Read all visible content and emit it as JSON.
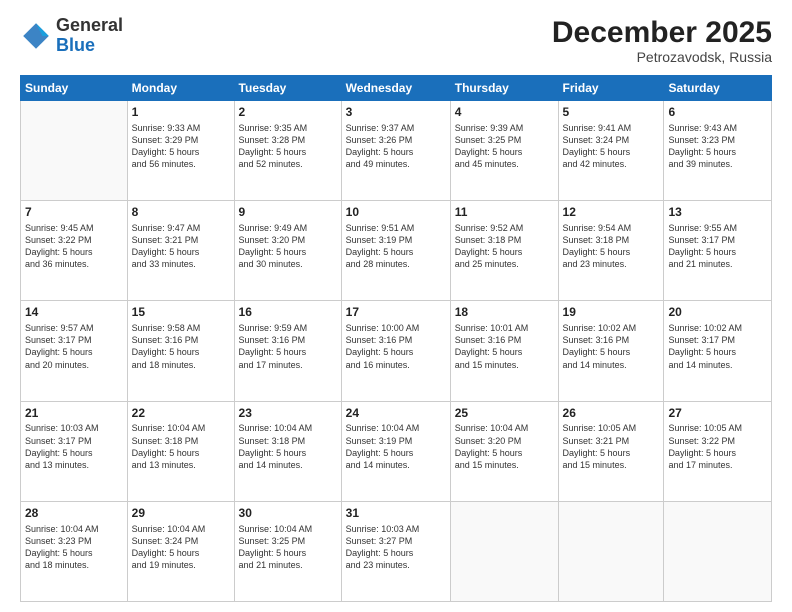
{
  "header": {
    "logo_general": "General",
    "logo_blue": "Blue",
    "month_year": "December 2025",
    "location": "Petrozavodsk, Russia"
  },
  "weekdays": [
    "Sunday",
    "Monday",
    "Tuesday",
    "Wednesday",
    "Thursday",
    "Friday",
    "Saturday"
  ],
  "weeks": [
    [
      {
        "day": "",
        "info": ""
      },
      {
        "day": "1",
        "info": "Sunrise: 9:33 AM\nSunset: 3:29 PM\nDaylight: 5 hours\nand 56 minutes."
      },
      {
        "day": "2",
        "info": "Sunrise: 9:35 AM\nSunset: 3:28 PM\nDaylight: 5 hours\nand 52 minutes."
      },
      {
        "day": "3",
        "info": "Sunrise: 9:37 AM\nSunset: 3:26 PM\nDaylight: 5 hours\nand 49 minutes."
      },
      {
        "day": "4",
        "info": "Sunrise: 9:39 AM\nSunset: 3:25 PM\nDaylight: 5 hours\nand 45 minutes."
      },
      {
        "day": "5",
        "info": "Sunrise: 9:41 AM\nSunset: 3:24 PM\nDaylight: 5 hours\nand 42 minutes."
      },
      {
        "day": "6",
        "info": "Sunrise: 9:43 AM\nSunset: 3:23 PM\nDaylight: 5 hours\nand 39 minutes."
      }
    ],
    [
      {
        "day": "7",
        "info": "Sunrise: 9:45 AM\nSunset: 3:22 PM\nDaylight: 5 hours\nand 36 minutes."
      },
      {
        "day": "8",
        "info": "Sunrise: 9:47 AM\nSunset: 3:21 PM\nDaylight: 5 hours\nand 33 minutes."
      },
      {
        "day": "9",
        "info": "Sunrise: 9:49 AM\nSunset: 3:20 PM\nDaylight: 5 hours\nand 30 minutes."
      },
      {
        "day": "10",
        "info": "Sunrise: 9:51 AM\nSunset: 3:19 PM\nDaylight: 5 hours\nand 28 minutes."
      },
      {
        "day": "11",
        "info": "Sunrise: 9:52 AM\nSunset: 3:18 PM\nDaylight: 5 hours\nand 25 minutes."
      },
      {
        "day": "12",
        "info": "Sunrise: 9:54 AM\nSunset: 3:18 PM\nDaylight: 5 hours\nand 23 minutes."
      },
      {
        "day": "13",
        "info": "Sunrise: 9:55 AM\nSunset: 3:17 PM\nDaylight: 5 hours\nand 21 minutes."
      }
    ],
    [
      {
        "day": "14",
        "info": "Sunrise: 9:57 AM\nSunset: 3:17 PM\nDaylight: 5 hours\nand 20 minutes."
      },
      {
        "day": "15",
        "info": "Sunrise: 9:58 AM\nSunset: 3:16 PM\nDaylight: 5 hours\nand 18 minutes."
      },
      {
        "day": "16",
        "info": "Sunrise: 9:59 AM\nSunset: 3:16 PM\nDaylight: 5 hours\nand 17 minutes."
      },
      {
        "day": "17",
        "info": "Sunrise: 10:00 AM\nSunset: 3:16 PM\nDaylight: 5 hours\nand 16 minutes."
      },
      {
        "day": "18",
        "info": "Sunrise: 10:01 AM\nSunset: 3:16 PM\nDaylight: 5 hours\nand 15 minutes."
      },
      {
        "day": "19",
        "info": "Sunrise: 10:02 AM\nSunset: 3:16 PM\nDaylight: 5 hours\nand 14 minutes."
      },
      {
        "day": "20",
        "info": "Sunrise: 10:02 AM\nSunset: 3:17 PM\nDaylight: 5 hours\nand 14 minutes."
      }
    ],
    [
      {
        "day": "21",
        "info": "Sunrise: 10:03 AM\nSunset: 3:17 PM\nDaylight: 5 hours\nand 13 minutes."
      },
      {
        "day": "22",
        "info": "Sunrise: 10:04 AM\nSunset: 3:18 PM\nDaylight: 5 hours\nand 13 minutes."
      },
      {
        "day": "23",
        "info": "Sunrise: 10:04 AM\nSunset: 3:18 PM\nDaylight: 5 hours\nand 14 minutes."
      },
      {
        "day": "24",
        "info": "Sunrise: 10:04 AM\nSunset: 3:19 PM\nDaylight: 5 hours\nand 14 minutes."
      },
      {
        "day": "25",
        "info": "Sunrise: 10:04 AM\nSunset: 3:20 PM\nDaylight: 5 hours\nand 15 minutes."
      },
      {
        "day": "26",
        "info": "Sunrise: 10:05 AM\nSunset: 3:21 PM\nDaylight: 5 hours\nand 15 minutes."
      },
      {
        "day": "27",
        "info": "Sunrise: 10:05 AM\nSunset: 3:22 PM\nDaylight: 5 hours\nand 17 minutes."
      }
    ],
    [
      {
        "day": "28",
        "info": "Sunrise: 10:04 AM\nSunset: 3:23 PM\nDaylight: 5 hours\nand 18 minutes."
      },
      {
        "day": "29",
        "info": "Sunrise: 10:04 AM\nSunset: 3:24 PM\nDaylight: 5 hours\nand 19 minutes."
      },
      {
        "day": "30",
        "info": "Sunrise: 10:04 AM\nSunset: 3:25 PM\nDaylight: 5 hours\nand 21 minutes."
      },
      {
        "day": "31",
        "info": "Sunrise: 10:03 AM\nSunset: 3:27 PM\nDaylight: 5 hours\nand 23 minutes."
      },
      {
        "day": "",
        "info": ""
      },
      {
        "day": "",
        "info": ""
      },
      {
        "day": "",
        "info": ""
      }
    ]
  ]
}
